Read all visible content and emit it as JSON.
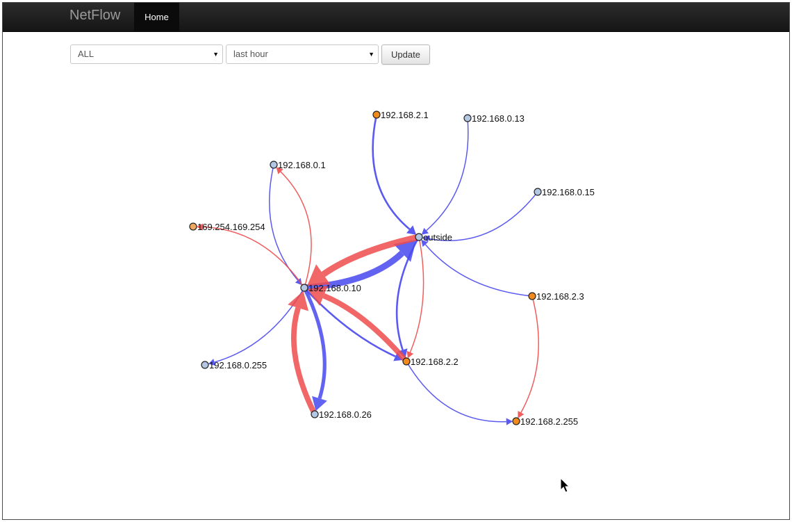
{
  "app": {
    "brand": "NetFlow",
    "nav": [
      {
        "label": "Home",
        "active": true
      }
    ]
  },
  "filters": {
    "host_select": {
      "value": "ALL"
    },
    "period_select": {
      "value": "last hour"
    },
    "update_button": "Update"
  },
  "colors": {
    "outgoing_edge": "#ee4b4b",
    "incoming_edge": "#4848ee",
    "internal_node": "#b3c6e2",
    "external_node": "#f08a1c",
    "external_node_light": "#f0a860"
  },
  "graph": {
    "nodes": [
      {
        "id": "192.168.2.1",
        "label": "192.168.2.1",
        "kind": "orange"
      },
      {
        "id": "192.168.0.13",
        "label": "192.168.0.13",
        "kind": "blue"
      },
      {
        "id": "192.168.0.1",
        "label": "192.168.0.1",
        "kind": "blue"
      },
      {
        "id": "192.168.0.15",
        "label": "192.168.0.15",
        "kind": "blue"
      },
      {
        "id": "169.254.169.254",
        "label": "169.254.169.254",
        "kind": "lightorange"
      },
      {
        "id": "outside",
        "label": "outside",
        "kind": "blue"
      },
      {
        "id": "192.168.0.10",
        "label": "192.168.0.10",
        "kind": "blue"
      },
      {
        "id": "192.168.2.3",
        "label": "192.168.2.3",
        "kind": "orange"
      },
      {
        "id": "192.168.2.2",
        "label": "192.168.2.2",
        "kind": "orange"
      },
      {
        "id": "192.168.0.255",
        "label": "192.168.0.255",
        "kind": "blue"
      },
      {
        "id": "192.168.0.26",
        "label": "192.168.0.26",
        "kind": "blue"
      },
      {
        "id": "192.168.2.255",
        "label": "192.168.2.255",
        "kind": "orange"
      }
    ],
    "edges": [
      {
        "from": "192.168.2.1",
        "to": "outside",
        "color": "blue",
        "weight": 2
      },
      {
        "from": "192.168.0.13",
        "to": "outside",
        "color": "blue",
        "weight": 1
      },
      {
        "from": "192.168.0.15",
        "to": "outside",
        "color": "blue",
        "weight": 1
      },
      {
        "from": "192.168.0.10",
        "to": "outside",
        "color": "blue",
        "weight": 7
      },
      {
        "from": "outside",
        "to": "192.168.0.10",
        "color": "red",
        "weight": 7
      },
      {
        "from": "outside",
        "to": "192.168.2.2",
        "color": "blue",
        "weight": 2
      },
      {
        "from": "outside",
        "to": "192.168.2.2",
        "color": "red",
        "weight": 1
      },
      {
        "from": "192.168.2.3",
        "to": "outside",
        "color": "blue",
        "weight": 1
      },
      {
        "from": "192.168.0.1",
        "to": "192.168.0.10",
        "color": "blue",
        "weight": 1
      },
      {
        "from": "192.168.0.10",
        "to": "192.168.0.1",
        "color": "red",
        "weight": 1
      },
      {
        "from": "192.168.0.10",
        "to": "169.254.169.254",
        "color": "red",
        "weight": 1
      },
      {
        "from": "192.168.0.10",
        "to": "192.168.0.255",
        "color": "blue",
        "weight": 1
      },
      {
        "from": "192.168.0.10",
        "to": "192.168.0.26",
        "color": "blue",
        "weight": 4
      },
      {
        "from": "192.168.0.26",
        "to": "192.168.0.10",
        "color": "red",
        "weight": 6
      },
      {
        "from": "192.168.0.10",
        "to": "192.168.2.2",
        "color": "blue",
        "weight": 2
      },
      {
        "from": "192.168.2.2",
        "to": "192.168.0.10",
        "color": "red",
        "weight": 6
      },
      {
        "from": "192.168.2.2",
        "to": "192.168.2.255",
        "color": "blue",
        "weight": 1
      },
      {
        "from": "192.168.2.3",
        "to": "192.168.2.255",
        "color": "red",
        "weight": 1
      }
    ]
  }
}
